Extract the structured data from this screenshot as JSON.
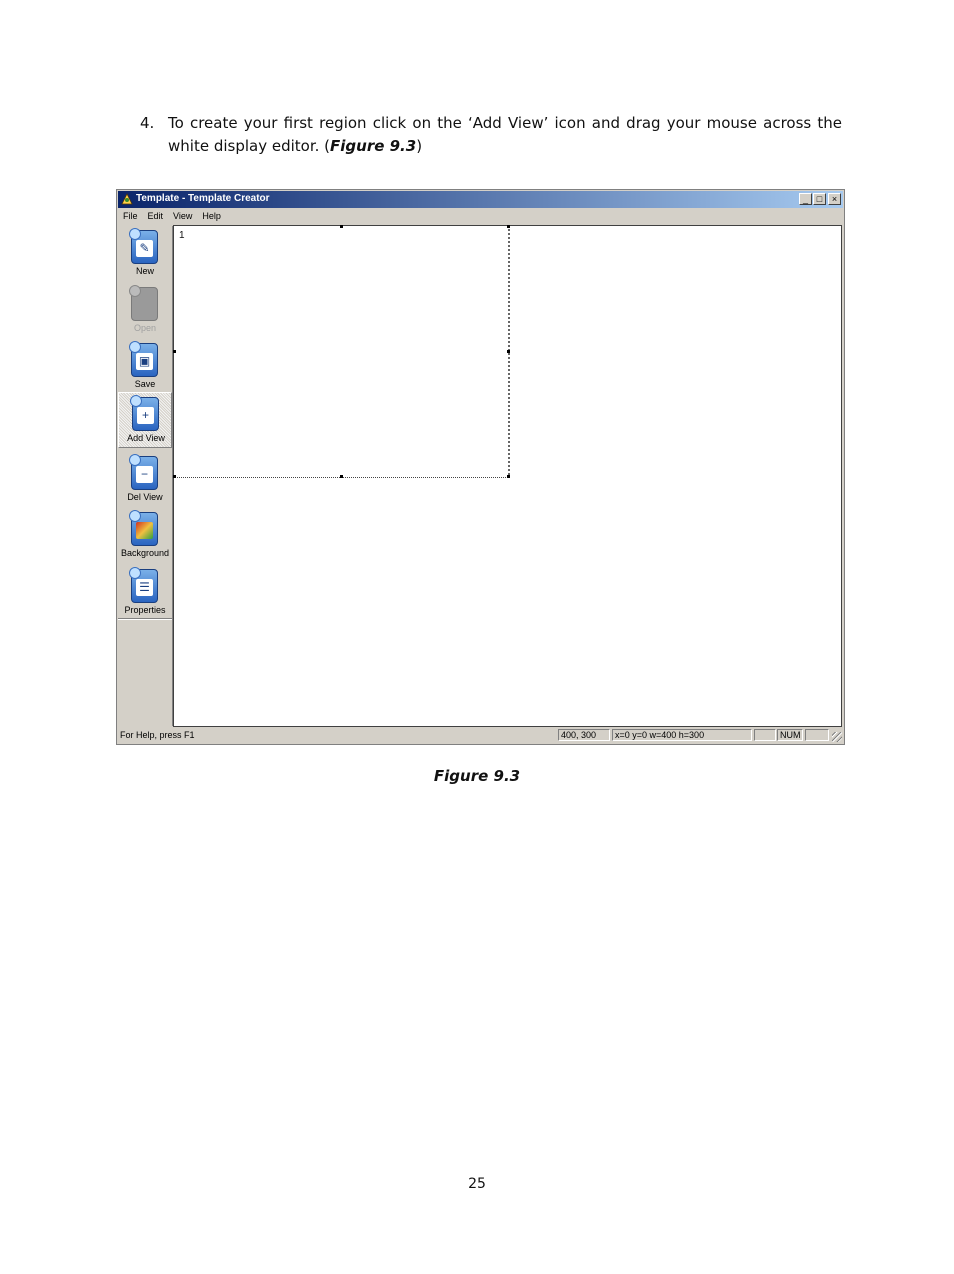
{
  "step": {
    "number": "4.",
    "text": "To create your first region click on the ‘Add View’ icon and drag your mouse across the white display editor. (",
    "figure_ref": "Figure 9.3",
    "close": ")"
  },
  "window": {
    "title": "Template - Template Creator",
    "controls": {
      "minimize": "_",
      "maximize": "□",
      "close": "×"
    }
  },
  "menu": [
    "File",
    "Edit",
    "View",
    "Help"
  ],
  "toolbar": {
    "new": "New",
    "open": "Open",
    "save": "Save",
    "add_view": "Add View",
    "del_view": "Del View",
    "background": "Background",
    "properties": "Properties"
  },
  "canvas": {
    "region_number": "1"
  },
  "status": {
    "help": "For Help, press F1",
    "size": "400, 300",
    "geometry": "x=0 y=0 w=400 h=300",
    "num": "NUM"
  },
  "caption": "Figure 9.3",
  "page_number": "25"
}
